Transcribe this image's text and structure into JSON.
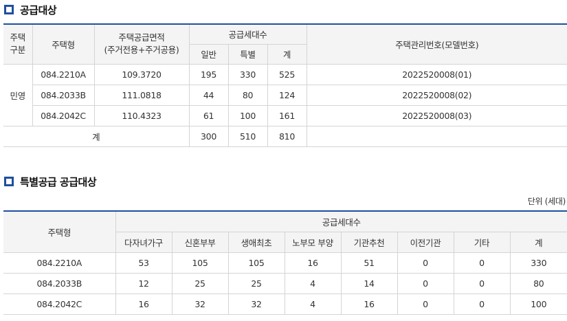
{
  "section1": {
    "title": "공급대상",
    "headers": {
      "housing_class": "주택\n구분",
      "housing_type": "주택형",
      "supply_area_line1": "주택공급면적",
      "supply_area_line2": "(주거전용+주거공용)",
      "units_group": "공급세대수",
      "general": "일반",
      "special": "특별",
      "total": "계",
      "management_no": "주택관리번호(모델번호)"
    },
    "class_label": "민영",
    "rows": [
      {
        "type": "084.2210A",
        "area": "109.3720",
        "general": "195",
        "special": "330",
        "total": "525",
        "mgmt": "2022520008(01)"
      },
      {
        "type": "084.2033B",
        "area": "111.0818",
        "general": "44",
        "special": "80",
        "total": "124",
        "mgmt": "2022520008(02)"
      },
      {
        "type": "084.2042C",
        "area": "110.4323",
        "general": "61",
        "special": "100",
        "total": "161",
        "mgmt": "2022520008(03)"
      }
    ],
    "totals": {
      "label": "계",
      "general": "300",
      "special": "510",
      "total": "810",
      "mgmt": ""
    }
  },
  "section2": {
    "title": "특별공급 공급대상",
    "unit": "단위 (세대)",
    "headers": {
      "housing_type": "주택형",
      "units_group": "공급세대수",
      "cols": [
        "다자녀가구",
        "신혼부부",
        "생애최초",
        "노부모 부양",
        "기관추천",
        "이전기관",
        "기타",
        "계"
      ]
    },
    "rows": [
      {
        "type": "084.2210A",
        "values": [
          "53",
          "105",
          "105",
          "16",
          "51",
          "0",
          "0",
          "330"
        ]
      },
      {
        "type": "084.2033B",
        "values": [
          "12",
          "25",
          "25",
          "4",
          "14",
          "0",
          "0",
          "80"
        ]
      },
      {
        "type": "084.2042C",
        "values": [
          "16",
          "32",
          "32",
          "4",
          "16",
          "0",
          "0",
          "100"
        ]
      }
    ]
  }
}
